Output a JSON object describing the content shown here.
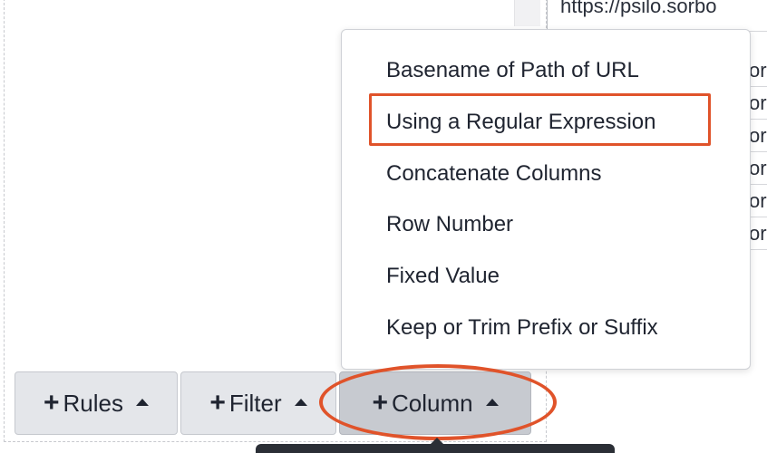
{
  "background_table": {
    "header_url": "https://psilo.sorbo",
    "row_fragments": [
      "or",
      "or",
      "or",
      "or",
      "or",
      "or"
    ]
  },
  "menu": {
    "items": [
      "Basename of Path of URL",
      "Using a Regular Expression",
      "Concatenate Columns",
      "Row Number",
      "Fixed Value",
      "Keep or Trim Prefix or Suffix"
    ],
    "highlighted_index": 1
  },
  "toolbar": {
    "rules_label": "Rules",
    "filter_label": "Filter",
    "column_label": "Column"
  },
  "colors": {
    "annotation": "#e0532a",
    "button_bg": "#e4e6ea",
    "active_button_bg": "#c7cad0"
  }
}
